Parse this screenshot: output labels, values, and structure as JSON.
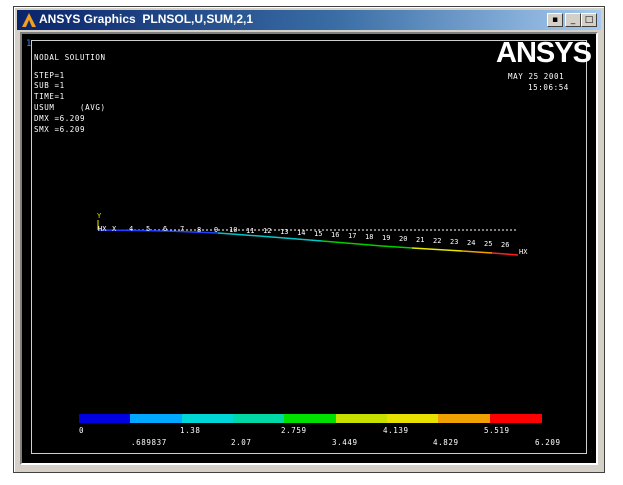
{
  "window": {
    "title": "ANSYS Graphics  PLNSOL,U,SUM,2,1",
    "buttons": {
      "extra": "▪",
      "minimize": "_",
      "maximize": "□",
      "close": "×"
    }
  },
  "plot": {
    "window_number": "1",
    "logo": "ANSYS",
    "info_lines": [
      "NODAL SOLUTION",
      "STEP=1",
      "SUB =1",
      "TIME=1",
      "USUM     (AVG)",
      "DMX =6.209",
      "SMX =6.209"
    ],
    "date": "MAY 25 2001",
    "time": "15:06:54",
    "axis_y_label": "Y",
    "axis_x_label": "X",
    "node_labels": [
      "4",
      "5",
      "6",
      "7",
      "8",
      "9",
      "10",
      "11",
      "12",
      "13",
      "14",
      "15",
      "16",
      "17",
      "18",
      "19",
      "20",
      "21",
      "22",
      "23",
      "24",
      "25",
      "26"
    ],
    "end_markers": [
      "HX",
      "HX"
    ]
  },
  "colorbar": {
    "colors": [
      "#0000e0",
      "#00a8ff",
      "#00d8d8",
      "#00d8a8",
      "#00e000",
      "#c8e000",
      "#e8e000",
      "#f0a000",
      "#ff0000"
    ],
    "labels_top": [
      "0",
      "1.38",
      "2.759",
      "4.139",
      "5.519"
    ],
    "labels_bottom": [
      ".689837",
      "2.07",
      "3.449",
      "4.829",
      "6.209"
    ]
  }
}
